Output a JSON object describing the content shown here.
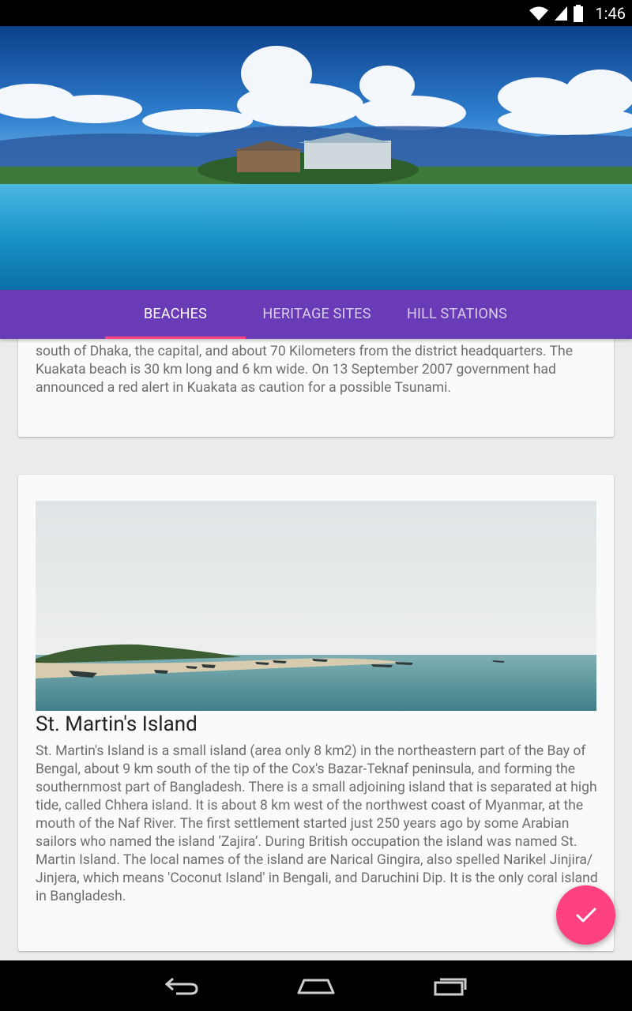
{
  "status_bar": {
    "time": "1:46",
    "icons": [
      "wifi-icon",
      "cell-signal-icon",
      "battery-icon"
    ]
  },
  "hero": {
    "image": "lake-house-landscape"
  },
  "tabs": [
    {
      "label": "BEACHES",
      "active": true
    },
    {
      "label": "HERITAGE SITES",
      "active": false
    },
    {
      "label": "HILL STATIONS",
      "active": false
    }
  ],
  "cards": [
    {
      "title": "",
      "text": "south of Dhaka, the capital, and about 70 Kilometers from the district headquarters. The Kuakata beach is 30 km long and 6 km wide. On 13 September 2007 government had announced a red alert in Kuakata as caution for a possible Tsunami."
    },
    {
      "title": "St. Martin's Island",
      "image": "island-coast-photo",
      "text": "St. Martin's Island is a small island (area only 8 km2) in the northeastern part of the Bay of Bengal, about 9 km south of the tip of the Cox's Bazar-Teknaf peninsula, and forming the southernmost part of Bangladesh. There is a small adjoining island that is separated at high tide, called Chhera island. It is about 8 km west of the northwest coast of Myanmar, at the mouth of the Naf River. The first settlement started just 250 years ago by some Arabian sailors who named the island ‘Zajira’. During British occupation the island was named St. Martin Island. The local names of the island are Narical Gingira, also spelled Narikel Jinjira/ Jinjera, which means 'Coconut Island' in Bengali, and Daruchini Dip. It is the only coral island in Bangladesh."
    }
  ],
  "fab": {
    "icon": "check-icon"
  },
  "nav": {
    "icons": [
      "back-icon",
      "home-icon",
      "recents-icon"
    ]
  },
  "colors": {
    "primary": "#6a3bb6",
    "accent": "#ff4081",
    "card_bg": "#fafafa",
    "page_bg": "#ececec"
  }
}
